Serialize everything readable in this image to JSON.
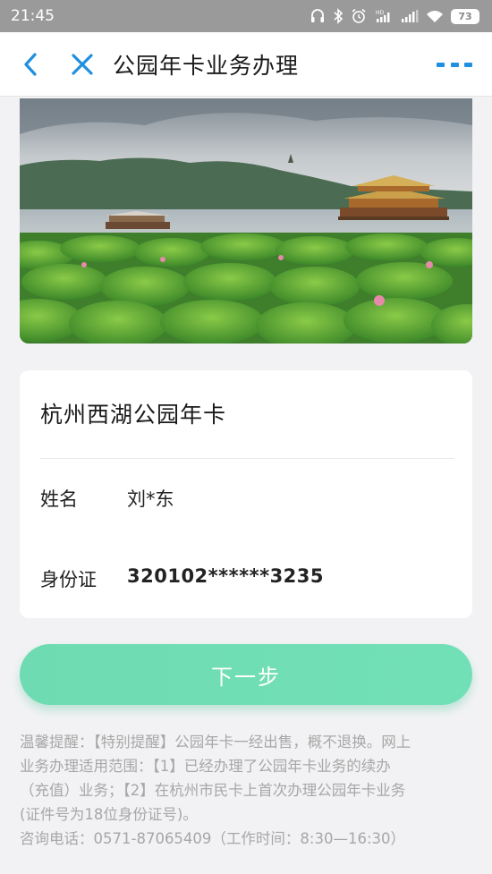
{
  "status_bar": {
    "time": "21:45",
    "battery": "73",
    "icons": [
      "headphones-icon",
      "bluetooth-icon",
      "alarm-icon",
      "signal-hd-icon",
      "signal-icon",
      "wifi-icon",
      "battery-icon"
    ]
  },
  "nav": {
    "title": "公园年卡业务办理",
    "back_icon": "chevron-left-icon",
    "close_icon": "close-icon",
    "more_icon": "more-icon",
    "accent_color": "#1f8fe0"
  },
  "banner": {
    "image": "west-lake-lotus-photo"
  },
  "card": {
    "title": "杭州西湖公园年卡",
    "name_label": "姓名",
    "name_value": "刘*东",
    "id_label": "身份证",
    "id_value": "320102******3235"
  },
  "next_button": {
    "label": "下一步",
    "color": "#6fdbb2"
  },
  "notice": {
    "lines": [
      "温馨提醒：【特别提醒】公园年卡一经出售，概不退换。网上",
      "业务办理适用范围：【1】已经办理了公园年卡业务的续办",
      "（充值）业务；【2】在杭州市民卡上首次办理公园年卡业务",
      "(证件号为18位身份证号)。",
      "咨询电话：0571-87065409（工作时间：8:30—16:30）"
    ]
  }
}
